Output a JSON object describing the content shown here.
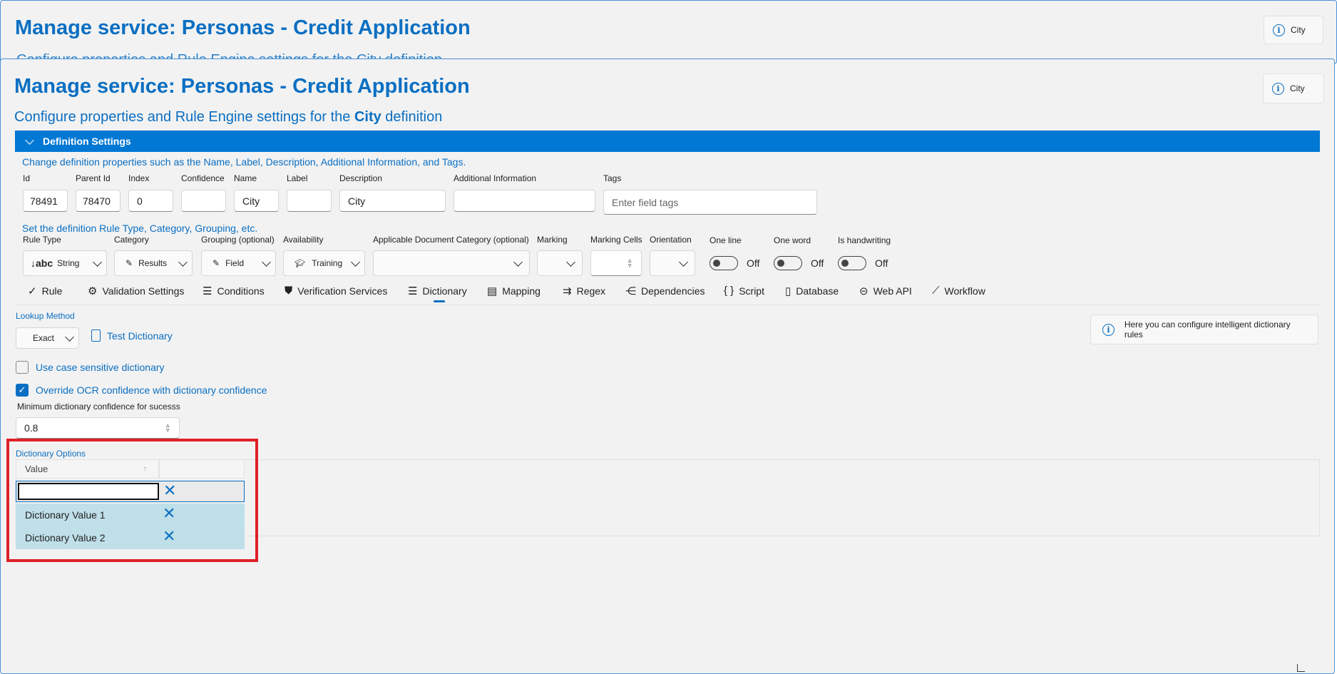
{
  "back_window": {
    "title": "Manage service: Personas - Credit Application",
    "subtitle_partial": "Configure properties and Rule Engine settings for the City definition",
    "info_button": "City"
  },
  "window": {
    "title": "Manage service: Personas - Credit Application",
    "info_button": "City",
    "subtitle_prefix": "Configure properties and Rule Engine settings for the ",
    "subtitle_bold": "City",
    "subtitle_suffix": " definition"
  },
  "definition_settings": {
    "header": "Definition Settings",
    "desc": "Change definition properties such as the Name, Label, Description, Additional Information, and Tags.",
    "fields": {
      "id": {
        "label": "Id",
        "value": "78491"
      },
      "parent_id": {
        "label": "Parent Id",
        "value": "78470"
      },
      "index": {
        "label": "Index",
        "value": "0"
      },
      "confidence": {
        "label": "Confidence",
        "value": ""
      },
      "name": {
        "label": "Name",
        "value": "City"
      },
      "label": {
        "label": "Label",
        "value": ""
      },
      "description": {
        "label": "Description",
        "value": "City"
      },
      "additional_info": {
        "label": "Additional Information",
        "value": ""
      },
      "tags": {
        "label": "Tags",
        "placeholder": "Enter field tags"
      }
    },
    "rule_desc": "Set the definition Rule Type, Category, Grouping, etc.",
    "rule_fields": {
      "rule_type": {
        "label": "Rule Type",
        "value": "String",
        "icon": "↓abc"
      },
      "category": {
        "label": "Category",
        "value": "Results"
      },
      "grouping": {
        "label": "Grouping (optional)",
        "value": "Field"
      },
      "availability": {
        "label": "Availability",
        "value": "Training"
      },
      "doc_category": {
        "label": "Applicable Document Category (optional)",
        "value": ""
      },
      "marking": {
        "label": "Marking",
        "value": ""
      },
      "marking_cells": {
        "label": "Marking Cells",
        "value": ""
      },
      "orientation": {
        "label": "Orientation",
        "value": ""
      },
      "one_line": {
        "label": "One line",
        "state": "Off"
      },
      "one_word": {
        "label": "One word",
        "state": "Off"
      },
      "handwriting": {
        "label": "Is handwriting",
        "state": "Off"
      }
    }
  },
  "tabs": [
    "Rule",
    "Validation Settings",
    "Conditions",
    "Verification Services",
    "Dictionary",
    "Mapping",
    "Regex",
    "Dependencies",
    "Script",
    "Database",
    "Web API",
    "Workflow"
  ],
  "active_tab": "Dictionary",
  "dictionary": {
    "lookup_label": "Lookup Method",
    "lookup_value": "Exact",
    "test_button": "Test Dictionary",
    "info_text": "Here you can configure intelligent dictionary rules",
    "case_sensitive_label": "Use case sensitive dictionary",
    "case_sensitive_checked": false,
    "override_label": "Override OCR confidence with dictionary confidence",
    "override_checked": true,
    "min_conf_label": "Minimum dictionary confidence for sucesss",
    "min_conf_value": "0.8",
    "options_label": "Dictionary Options",
    "column_header": "Value",
    "new_value": "",
    "values": [
      "Dictionary Value 1",
      "Dictionary Value 2"
    ]
  },
  "colors": {
    "accent": "#0078d4",
    "title_blue": "#0a6fc2",
    "highlight_box": "#e0202a",
    "row_selected": "#bfdfe9"
  }
}
